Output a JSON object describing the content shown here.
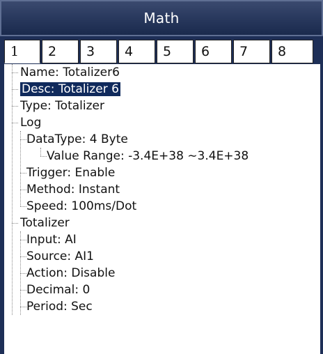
{
  "window": {
    "title": "Math"
  },
  "tabs": [
    "1",
    "2",
    "3",
    "4",
    "5",
    "6",
    "7",
    "8"
  ],
  "tree": [
    {
      "label": "Name: Totalizer6",
      "level": 0
    },
    {
      "label": "Desc: Totalizer 6",
      "level": 0,
      "selected": true
    },
    {
      "label": "Type: Totalizer",
      "level": 0
    },
    {
      "label": "Log",
      "level": 0
    },
    {
      "label": "DataType: 4 Byte",
      "level": 1
    },
    {
      "label": "Value Range: -3.4E+38 ∼3.4E+38",
      "level": 2
    },
    {
      "label": "Trigger: Enable",
      "level": 1
    },
    {
      "label": "Method: Instant",
      "level": 1
    },
    {
      "label": "Speed: 100ms/Dot",
      "level": 1
    },
    {
      "label": "Totalizer",
      "level": 0
    },
    {
      "label": "Input: AI",
      "level": 1
    },
    {
      "label": "Source: AI1",
      "level": 1
    },
    {
      "label": "Action: Disable",
      "level": 1
    },
    {
      "label": "Decimal: 0",
      "level": 1
    },
    {
      "label": "Period: Sec",
      "level": 1
    }
  ]
}
